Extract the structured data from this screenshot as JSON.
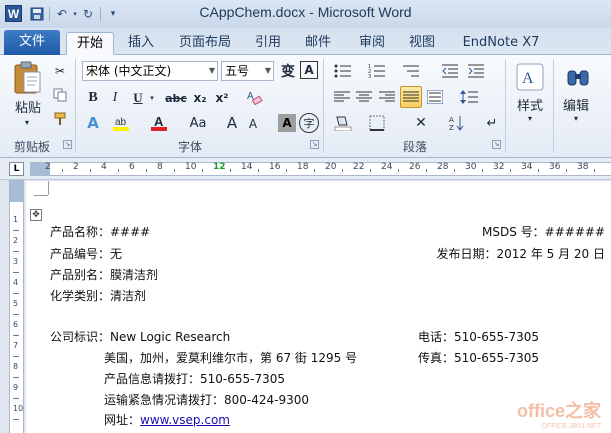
{
  "titlebar": {
    "title": "CAppChem.docx - Microsoft Word",
    "app_icon": "W",
    "qat_icons": [
      "save-icon",
      "undo-icon",
      "redo-icon",
      "customize-icon"
    ]
  },
  "tabs": {
    "file": "文件",
    "items": [
      "开始",
      "插入",
      "页面布局",
      "引用",
      "邮件",
      "审阅",
      "视图",
      "EndNote X7"
    ],
    "active": "开始"
  },
  "ribbon": {
    "clipboard": {
      "paste_label": "粘贴",
      "group_label": "剪贴板"
    },
    "font": {
      "font_name": "宋体 (中文正文)",
      "font_size": "五号",
      "group_label": "字体",
      "wen_glyph": "变",
      "a_glyph": "A",
      "bold": "B",
      "italic": "I",
      "underline": "U",
      "strike": "abc",
      "sub": "x₂",
      "sup": "x²",
      "clear": "Aa",
      "grow": "A",
      "shrink": "A",
      "char_shade": "A",
      "enclose": "字"
    },
    "paragraph": {
      "group_label": "段落"
    },
    "styles": {
      "label": "样式"
    },
    "editing": {
      "label": "编辑"
    }
  },
  "ruler": {
    "corner": "L",
    "ticks": [
      "2",
      "2",
      "4",
      "6",
      "8",
      "10",
      "12",
      "14",
      "16",
      "18",
      "20",
      "22",
      "24",
      "26",
      "28",
      "30",
      "32",
      "34",
      "36",
      "38"
    ],
    "vticks": [
      "1",
      "2",
      "3",
      "4",
      "5",
      "6",
      "7",
      "8",
      "9",
      "10"
    ]
  },
  "document": {
    "product_name": "产品名称：####",
    "msds_no": "MSDS 号：######",
    "product_code": "产品编号：无",
    "release_date": "发布日期：2012 年 5 月 20 日",
    "alias": "产品别名：膜清洁剂",
    "category": "化学类别：清洁剂",
    "company": "公司标识：New Logic Research",
    "phone": "电话：510-655-7305",
    "address": "美国，加州，爱莫利维尔市，第 67 街 1295 号",
    "fax": "传真：510-655-7305",
    "info_hotline": "产品信息请拨打：510-655-7305",
    "emergency": "运输紧急情况请拨打：800-424-9300",
    "website_label": "网址：",
    "website": "www.vsep.com"
  },
  "watermark": {
    "main": "office之家",
    "sub": "OFFICE.JB51.NET"
  }
}
